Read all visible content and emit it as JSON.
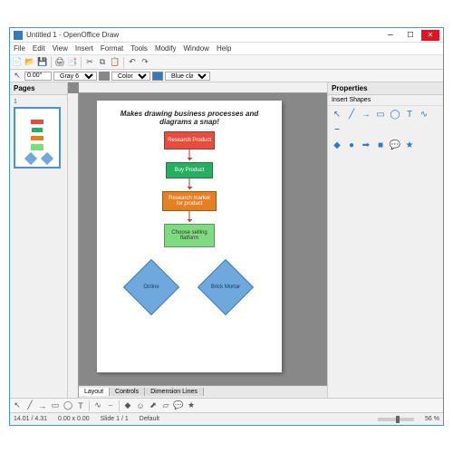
{
  "window": {
    "title": "Untitled 1 - OpenOffice Draw"
  },
  "menu": [
    "File",
    "Edit",
    "View",
    "Insert",
    "Format",
    "Tools",
    "Modify",
    "Window",
    "Help"
  ],
  "toolbar2": {
    "zoom": "0.00\"",
    "line_style": "Gray 6",
    "fill_label": "Color",
    "fill_style": "Blue classic"
  },
  "pages_panel": {
    "title": "Pages",
    "page_num": "1"
  },
  "doc": {
    "title": "Makes drawing business processes and diagrams a snap!",
    "box1": "Research Product",
    "box2": "Buy Product",
    "box3": "Research market for product",
    "box4": "Choose selling flatform",
    "diamond1": "Online",
    "diamond2": "Brick Mortar"
  },
  "bottom_tabs": [
    "Layout",
    "Controls",
    "Dimension Lines"
  ],
  "props": {
    "title": "Properties",
    "section": "Insert Shapes"
  },
  "status": {
    "pos": "14.01 / 4.31",
    "size": "0.00 x 0.00",
    "slide": "Slide 1 / 1",
    "layout": "Default",
    "zoom": "56 %"
  }
}
